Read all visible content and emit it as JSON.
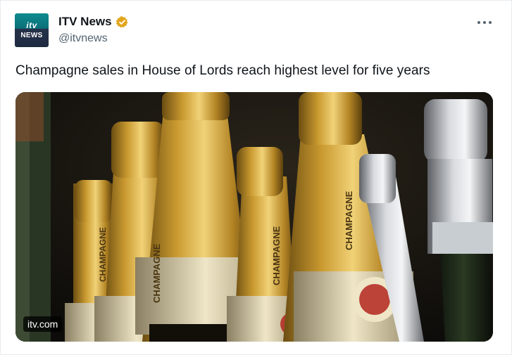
{
  "author": {
    "avatar_line1": "itv",
    "avatar_line2": "NEWS",
    "display_name": "ITV News",
    "handle": "@itvnews",
    "verified_color": "#e2a61d"
  },
  "tweet": {
    "text": "Champagne sales in House of Lords reach highest level for five years"
  },
  "media": {
    "source_label": "itv.com",
    "bottle_label": "CHAMPAGNE"
  },
  "icons": {
    "more": "more-horizontal-icon",
    "verified": "verified-badge-icon"
  }
}
